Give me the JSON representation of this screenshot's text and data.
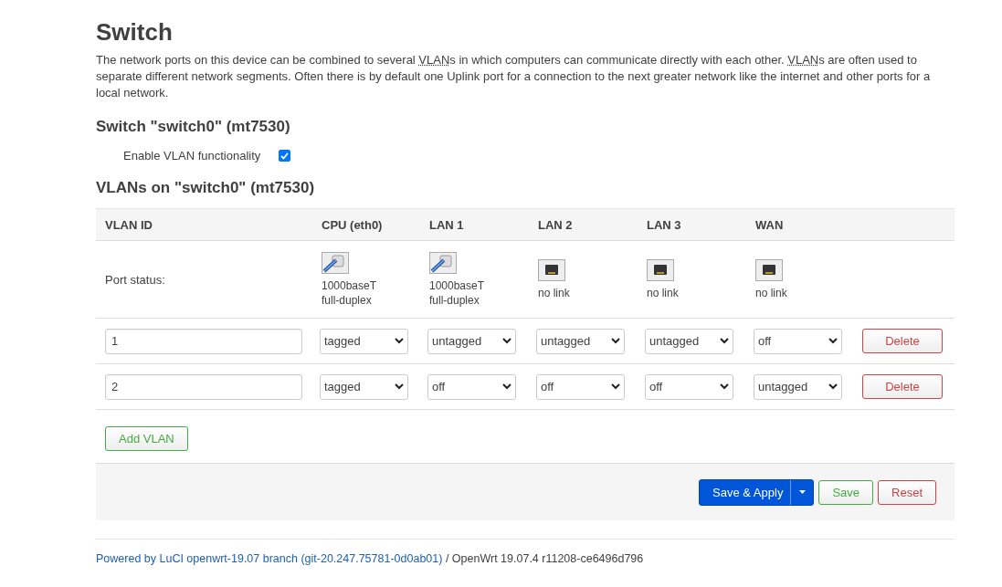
{
  "title": "Switch",
  "description": [
    {
      "kind": "text",
      "text": "The network ports on this device can be combined to several "
    },
    {
      "kind": "abbr",
      "text": "VLAN"
    },
    {
      "kind": "text",
      "text": "s in which computers can communicate directly with each other. "
    },
    {
      "kind": "abbr",
      "text": "VLAN"
    },
    {
      "kind": "text",
      "text": "s are often used to separate different network segments. Often there is by default one Uplink port for a connection to the next greater network like the internet and other ports for a local network."
    }
  ],
  "switch_section": {
    "heading": "Switch \"switch0\" (mt7530)",
    "option": {
      "label": "Enable VLAN functionality",
      "checked": true
    }
  },
  "vlan_section": {
    "heading": "VLANs on \"switch0\" (mt7530)",
    "columns": [
      "VLAN ID",
      "CPU (eth0)",
      "LAN 1",
      "LAN 2",
      "LAN 3",
      "WAN"
    ],
    "port_status": {
      "label": "Port status:",
      "ports": [
        {
          "linked": true,
          "lines": [
            "1000baseT",
            "full-duplex"
          ]
        },
        {
          "linked": true,
          "lines": [
            "1000baseT",
            "full-duplex"
          ]
        },
        {
          "linked": false,
          "lines": [
            "no link"
          ]
        },
        {
          "linked": false,
          "lines": [
            "no link"
          ]
        },
        {
          "linked": false,
          "lines": [
            "no link"
          ]
        }
      ]
    },
    "rows": [
      {
        "vlan_id": "1",
        "ports": [
          "tagged",
          "untagged",
          "untagged",
          "untagged",
          "off"
        ],
        "action": "Delete"
      },
      {
        "vlan_id": "2",
        "ports": [
          "tagged",
          "off",
          "off",
          "off",
          "untagged"
        ],
        "action": "Delete"
      }
    ],
    "add_button": "Add VLAN"
  },
  "actions": [
    {
      "kind": "primary",
      "label": "Save & Apply"
    },
    {
      "kind": "positive",
      "label": "Save"
    },
    {
      "kind": "negative",
      "label": "Reset"
    }
  ],
  "footer": {
    "link": "Powered by LuCI openwrt-19.07 branch (git-20.247.75781-0d0ab01)",
    "text": " / OpenWrt 19.07.4 r11208-ce6496d796"
  }
}
